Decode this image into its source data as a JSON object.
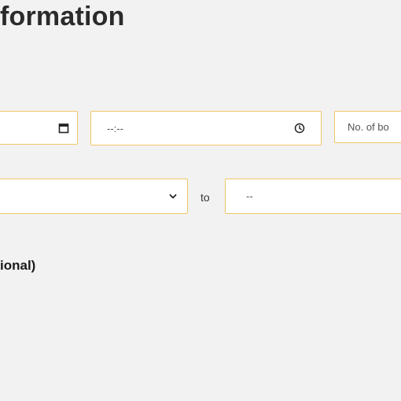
{
  "section": {
    "heading": "formation",
    "optional_label": "ional)"
  },
  "schedule": {
    "date_icon": "calendar-icon",
    "time_placeholder": "--:--",
    "time_icon": "clock-icon",
    "boxes_placeholder": "No. of bo"
  },
  "range": {
    "to_label": "to",
    "from_select_icon": "chevron-down-icon",
    "to_value": "--"
  },
  "colors": {
    "field_border": "#f1c768",
    "background": "#f2f2f2"
  }
}
